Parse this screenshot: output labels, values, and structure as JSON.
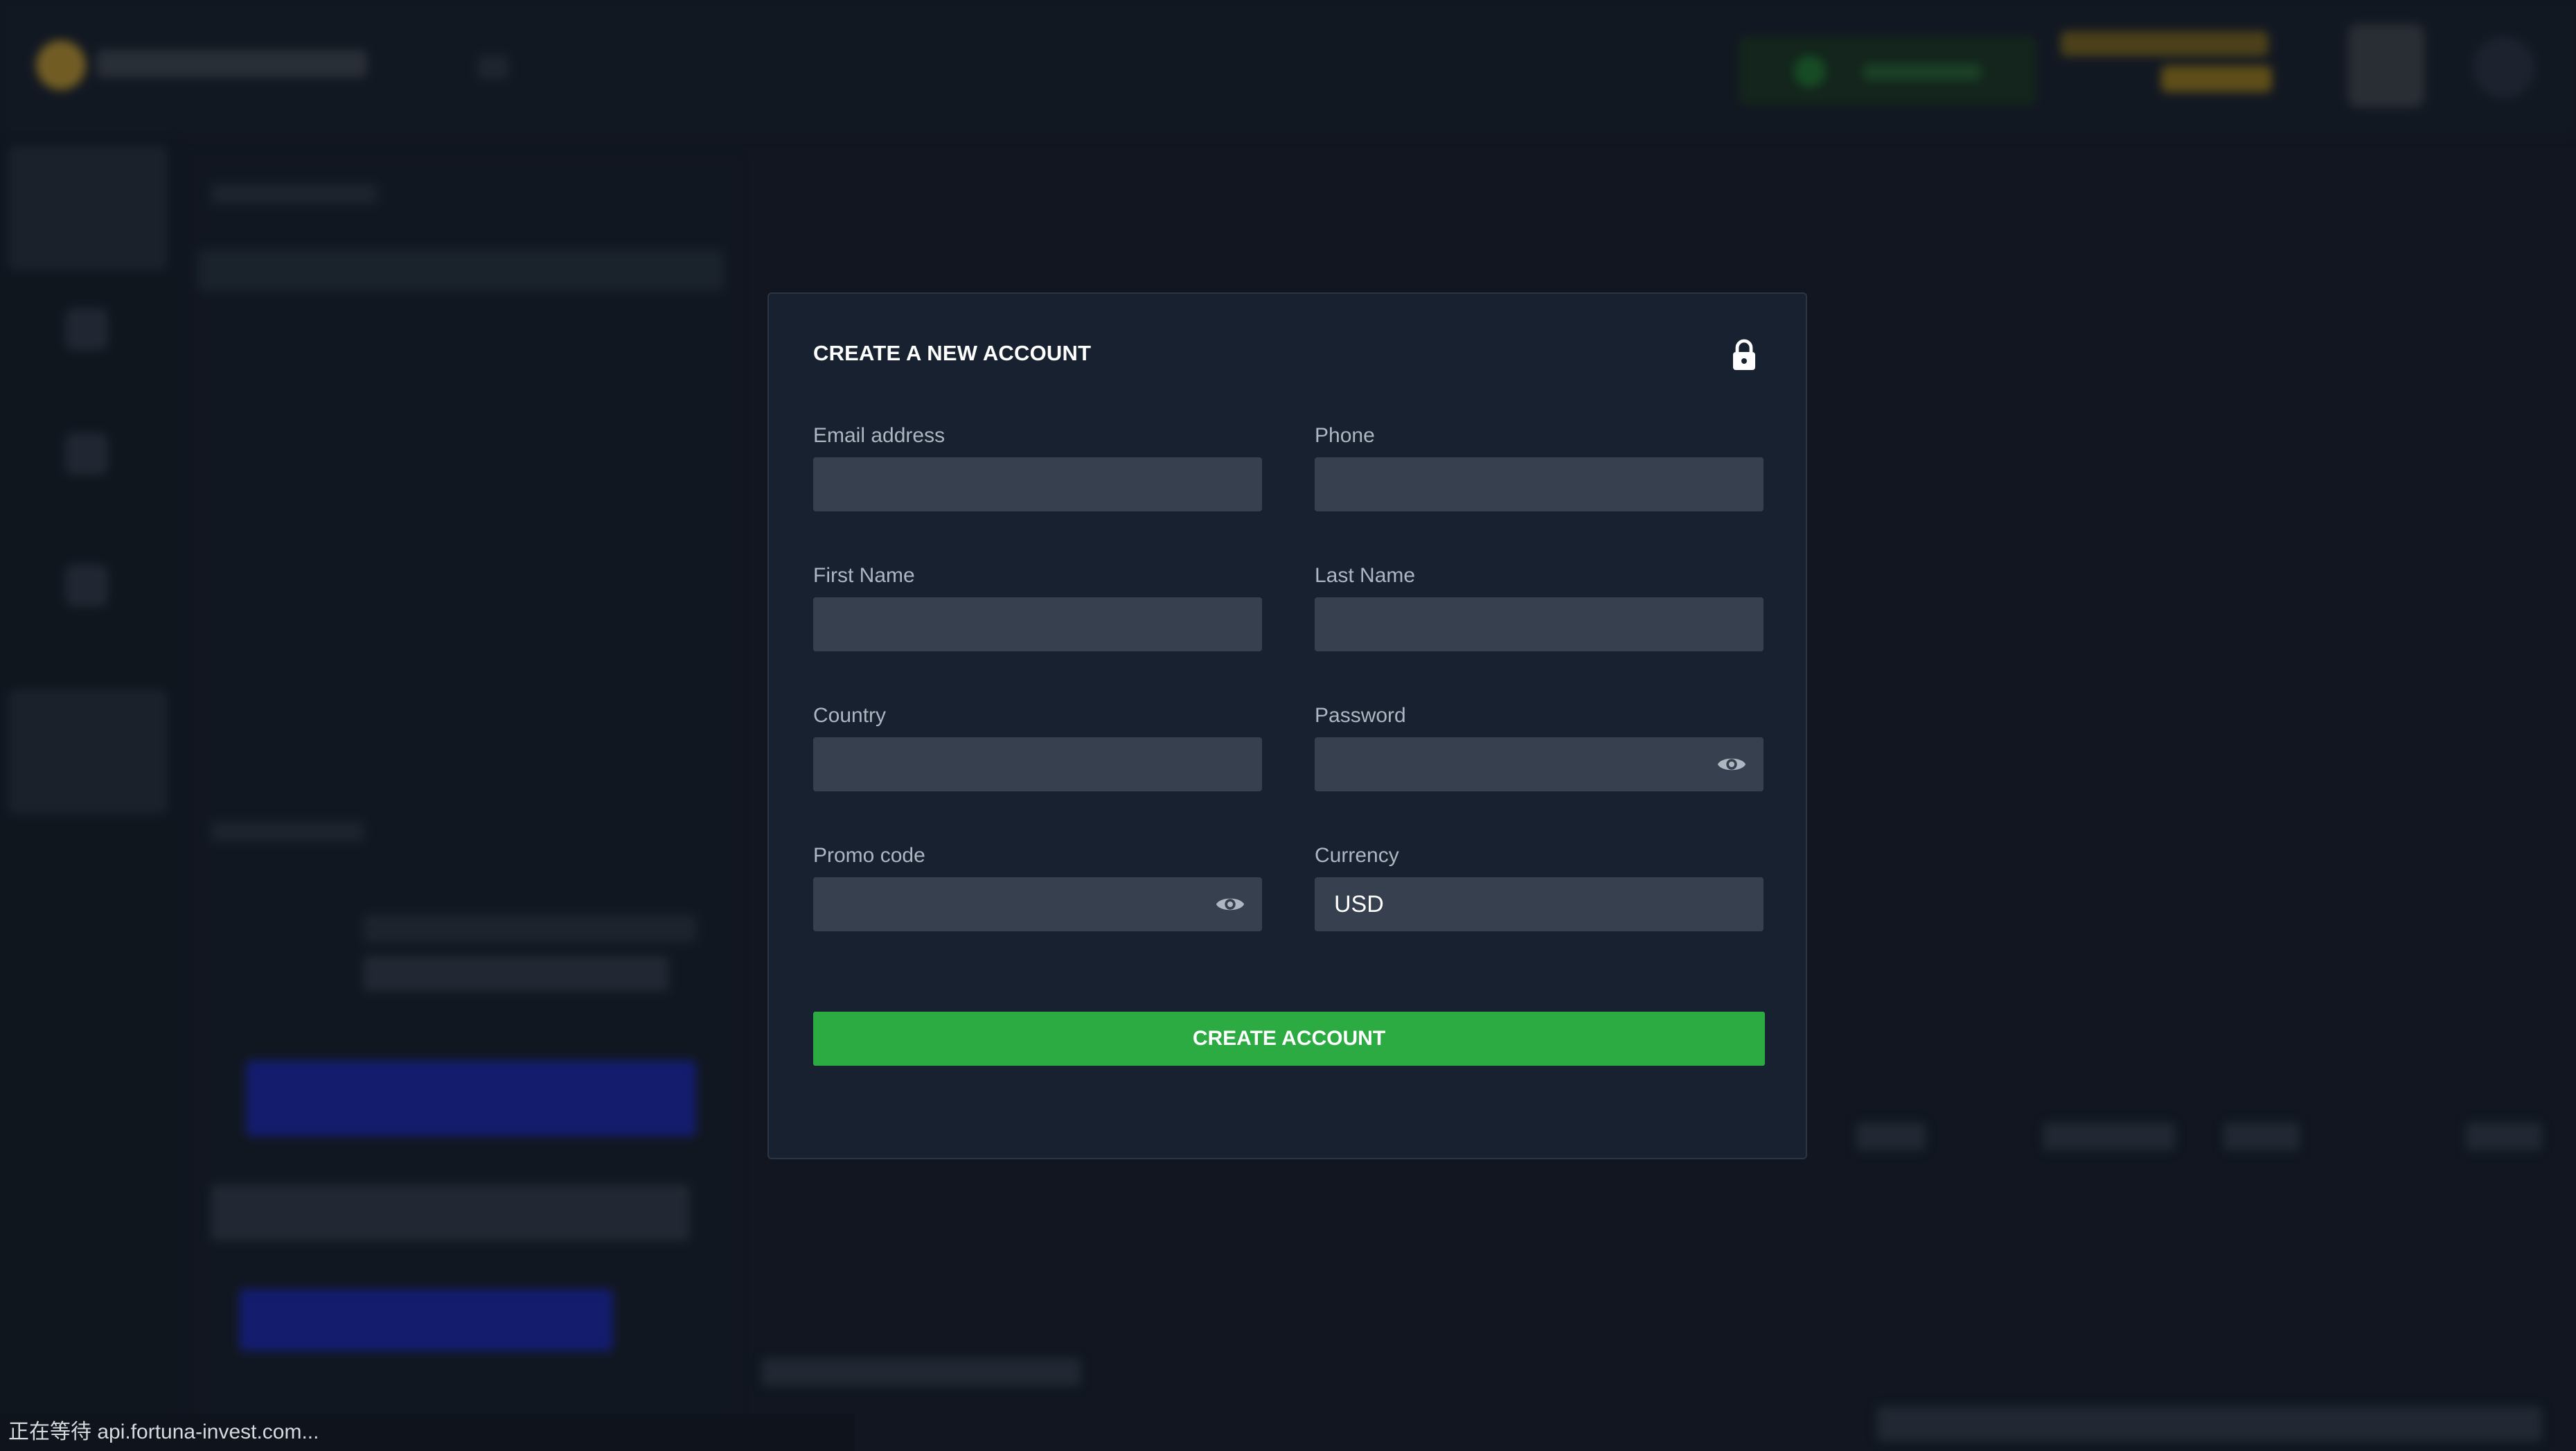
{
  "status_bar": {
    "text": "正在等待 api.fortuna-invest.com..."
  },
  "modal": {
    "title": "CREATE A NEW ACCOUNT",
    "lock_icon": "lock-icon",
    "fields": {
      "email": {
        "label": "Email address",
        "value": ""
      },
      "phone": {
        "label": "Phone",
        "value": ""
      },
      "first_name": {
        "label": "First Name",
        "value": ""
      },
      "last_name": {
        "label": "Last Name",
        "value": ""
      },
      "country": {
        "label": "Country",
        "value": ""
      },
      "password": {
        "label": "Password",
        "value": "",
        "toggle_icon": "eye-icon"
      },
      "promo_code": {
        "label": "Promo code",
        "value": "",
        "toggle_icon": "eye-icon"
      },
      "currency": {
        "label": "Currency",
        "value": "USD"
      }
    },
    "submit_label": "CREATE ACCOUNT"
  },
  "colors": {
    "page_bg": "#141a25",
    "modal_bg": "#172130",
    "input_bg": "#36404f",
    "accent_green": "#2bab41"
  }
}
